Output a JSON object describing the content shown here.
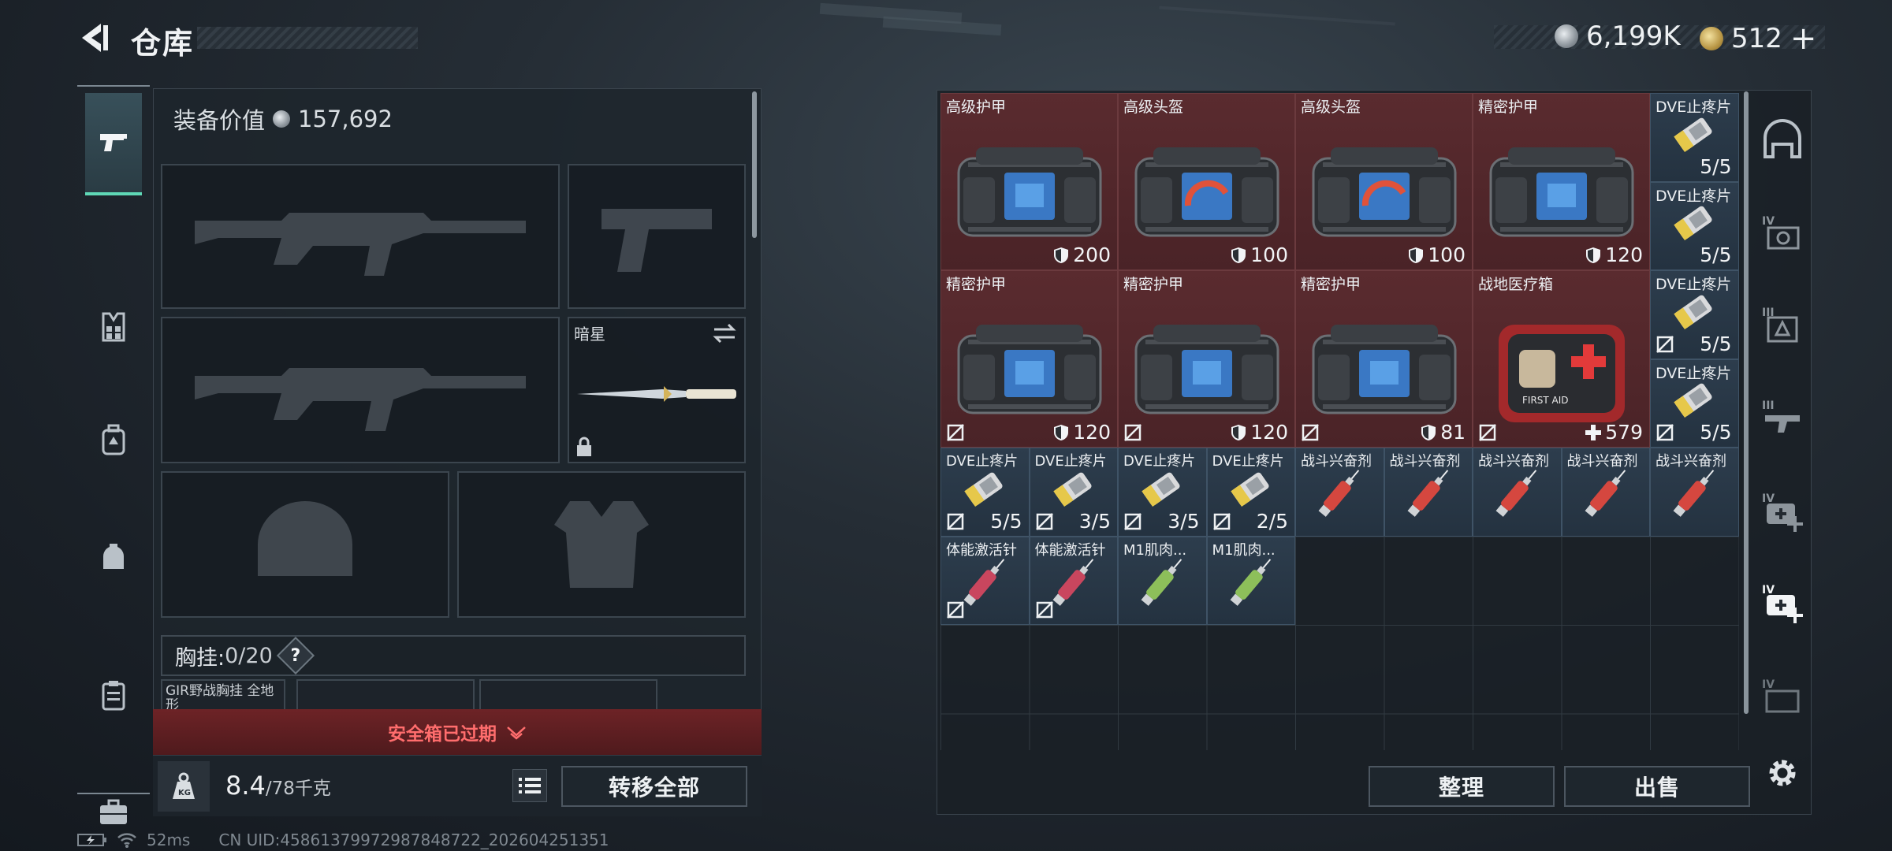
{
  "header": {
    "title": "仓库",
    "currency": [
      {
        "icon": "silver-coin-icon",
        "value": "6,199K"
      },
      {
        "icon": "gold-coin-icon",
        "value": "512",
        "add": "+"
      }
    ]
  },
  "loadout": {
    "value_label": "装备价值",
    "value": "157,692",
    "melee_name": "暗星",
    "chest_rig_label": "胸挂:",
    "chest_rig_capacity": "0/20",
    "help": "?",
    "chest_item_name": "GIR野战胸挂 全地形",
    "expired_text": "安全箱已过期",
    "weight_current": "8.4",
    "weight_max": "/78千克",
    "transfer_all": "转移全部"
  },
  "storage": {
    "items": [
      {
        "name": "高级护甲",
        "stat": "200",
        "type": "armor",
        "row": 0,
        "col": 0
      },
      {
        "name": "高级头盔",
        "stat": "100",
        "type": "helmet",
        "row": 0,
        "col": 1
      },
      {
        "name": "高级头盔",
        "stat": "100",
        "type": "helmet",
        "row": 0,
        "col": 2
      },
      {
        "name": "精密护甲",
        "stat": "120",
        "type": "armor",
        "row": 0,
        "col": 3
      },
      {
        "name": "精密护甲",
        "stat": "120",
        "type": "armor",
        "row": 1,
        "col": 0
      },
      {
        "name": "精密护甲",
        "stat": "120",
        "type": "armor",
        "row": 1,
        "col": 1
      },
      {
        "name": "精密护甲",
        "stat": "81",
        "type": "armor",
        "row": 1,
        "col": 2
      },
      {
        "name": "战地医疗箱",
        "stat": "579",
        "type": "medkit",
        "row": 1,
        "col": 3
      }
    ],
    "side_items": [
      {
        "name": "DVE止疼片",
        "stat": "5/5"
      },
      {
        "name": "DVE止疼片",
        "stat": "5/5"
      },
      {
        "name": "DVE止疼片",
        "stat": "5/5"
      },
      {
        "name": "DVE止疼片",
        "stat": "5/5"
      }
    ],
    "small_items": [
      {
        "name": "DVE止疼片",
        "stat": "5/5",
        "kind": "pill"
      },
      {
        "name": "DVE止疼片",
        "stat": "3/5",
        "kind": "pill"
      },
      {
        "name": "DVE止疼片",
        "stat": "3/5",
        "kind": "pill"
      },
      {
        "name": "DVE止疼片",
        "stat": "2/5",
        "kind": "pill"
      },
      {
        "name": "战斗兴奋剂",
        "stat": "",
        "kind": "syringe-red"
      },
      {
        "name": "战斗兴奋剂",
        "stat": "",
        "kind": "syringe-red"
      },
      {
        "name": "战斗兴奋剂",
        "stat": "",
        "kind": "syringe-red"
      },
      {
        "name": "战斗兴奋剂",
        "stat": "",
        "kind": "syringe-red"
      },
      {
        "name": "战斗兴奋剂",
        "stat": "",
        "kind": "syringe-red"
      },
      {
        "name": "体能激活针",
        "stat": "",
        "kind": "syringe-pink"
      },
      {
        "name": "体能激活针",
        "stat": "",
        "kind": "syringe-pink"
      },
      {
        "name": "M1肌肉...",
        "stat": "",
        "kind": "syringe-green"
      },
      {
        "name": "M1肌肉...",
        "stat": "",
        "kind": "syringe-green"
      }
    ],
    "sort_label": "整理",
    "sell_label": "出售"
  },
  "status": {
    "ping": "52ms",
    "uid": "CN UID:45861379972987848722_202604251351"
  },
  "colors": {
    "accent": "#5fd8b6",
    "expired": "#ff6d6d",
    "rare_bg": "#5a2b2f",
    "common_bg": "#2d3d4d"
  }
}
